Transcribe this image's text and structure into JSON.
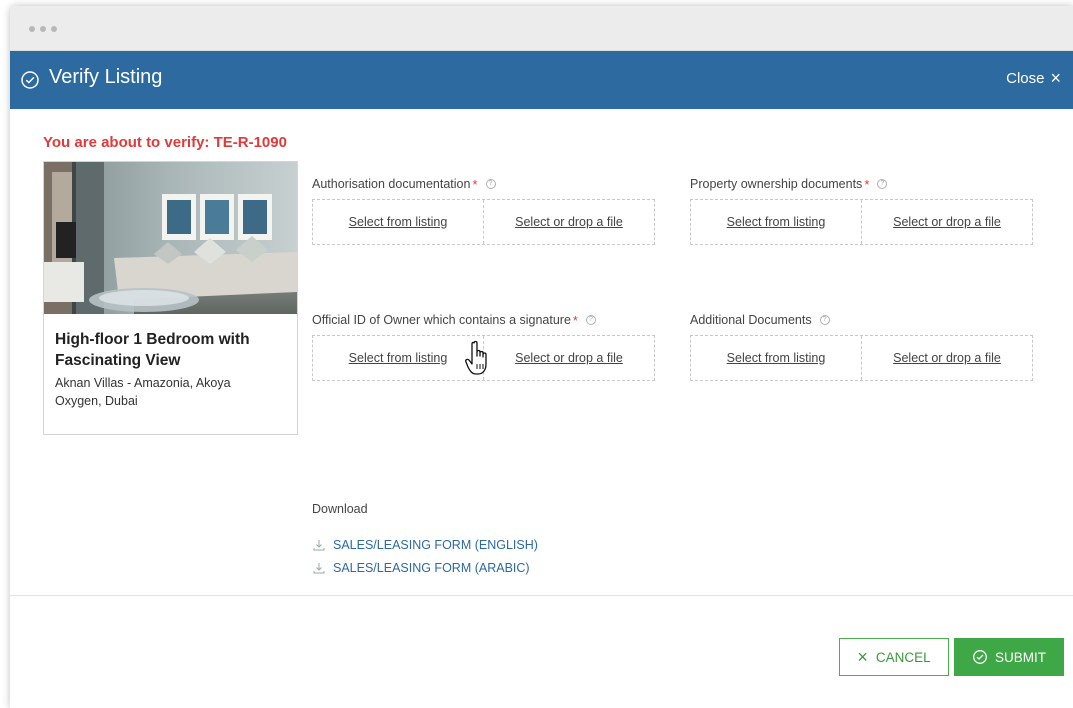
{
  "modal": {
    "title": "Verify Listing",
    "close_label": "Close"
  },
  "verify": {
    "prefix": "You are about to verify:",
    "listing_id": "TE-R-1090"
  },
  "listing": {
    "title": "High-floor 1 Bedroom with Fascinating View",
    "address": "Aknan Villas - Amazonia, Akoya Oxygen, Dubai"
  },
  "documents": [
    {
      "label": "Authorisation documentation",
      "required": true,
      "select_listing": "Select from listing",
      "select_file": "Select or drop a file"
    },
    {
      "label": "Property ownership documents",
      "required": true,
      "select_listing": "Select from listing",
      "select_file": "Select or drop a file"
    },
    {
      "label": "Official ID of Owner which contains a signature",
      "required": true,
      "select_listing": "Select from listing",
      "select_file": "Select or drop a file"
    },
    {
      "label": "Additional Documents",
      "required": false,
      "select_listing": "Select from listing",
      "select_file": "Select or drop a file"
    }
  ],
  "download": {
    "title": "Download",
    "links": [
      "SALES/LEASING FORM (ENGLISH)",
      "SALES/LEASING FORM (ARABIC)"
    ]
  },
  "buttons": {
    "cancel": "CANCEL",
    "submit": "SUBMIT"
  },
  "colors": {
    "header": "#2c6aa0",
    "warning": "#e03a3a",
    "success": "#3fa846",
    "link": "#2c6aa0"
  },
  "icons": {
    "header": "check-circle-icon",
    "close": "close-icon",
    "help": "help-icon",
    "download": "download-icon",
    "cursor": "hand-pointer-icon"
  }
}
